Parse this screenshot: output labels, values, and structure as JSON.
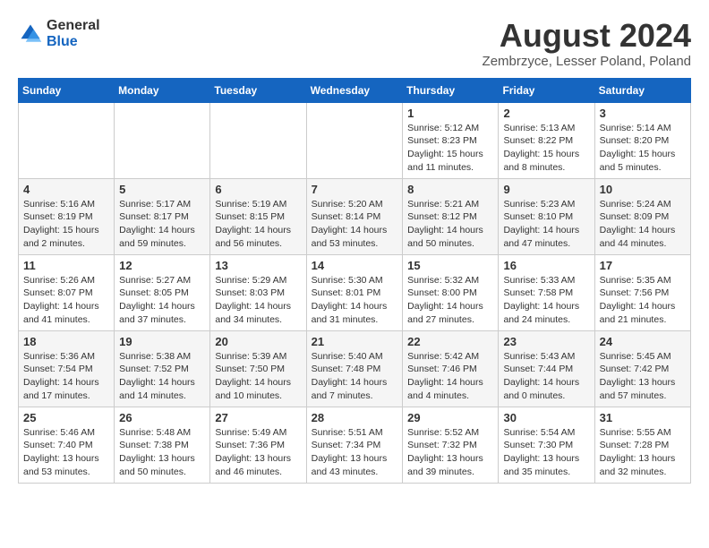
{
  "logo": {
    "general": "General",
    "blue": "Blue"
  },
  "header": {
    "title": "August 2024",
    "subtitle": "Zembrzyce, Lesser Poland, Poland"
  },
  "weekdays": [
    "Sunday",
    "Monday",
    "Tuesday",
    "Wednesday",
    "Thursday",
    "Friday",
    "Saturday"
  ],
  "weeks": [
    [
      {
        "day": "",
        "info": ""
      },
      {
        "day": "",
        "info": ""
      },
      {
        "day": "",
        "info": ""
      },
      {
        "day": "",
        "info": ""
      },
      {
        "day": "1",
        "info": "Sunrise: 5:12 AM\nSunset: 8:23 PM\nDaylight: 15 hours\nand 11 minutes."
      },
      {
        "day": "2",
        "info": "Sunrise: 5:13 AM\nSunset: 8:22 PM\nDaylight: 15 hours\nand 8 minutes."
      },
      {
        "day": "3",
        "info": "Sunrise: 5:14 AM\nSunset: 8:20 PM\nDaylight: 15 hours\nand 5 minutes."
      }
    ],
    [
      {
        "day": "4",
        "info": "Sunrise: 5:16 AM\nSunset: 8:19 PM\nDaylight: 15 hours\nand 2 minutes."
      },
      {
        "day": "5",
        "info": "Sunrise: 5:17 AM\nSunset: 8:17 PM\nDaylight: 14 hours\nand 59 minutes."
      },
      {
        "day": "6",
        "info": "Sunrise: 5:19 AM\nSunset: 8:15 PM\nDaylight: 14 hours\nand 56 minutes."
      },
      {
        "day": "7",
        "info": "Sunrise: 5:20 AM\nSunset: 8:14 PM\nDaylight: 14 hours\nand 53 minutes."
      },
      {
        "day": "8",
        "info": "Sunrise: 5:21 AM\nSunset: 8:12 PM\nDaylight: 14 hours\nand 50 minutes."
      },
      {
        "day": "9",
        "info": "Sunrise: 5:23 AM\nSunset: 8:10 PM\nDaylight: 14 hours\nand 47 minutes."
      },
      {
        "day": "10",
        "info": "Sunrise: 5:24 AM\nSunset: 8:09 PM\nDaylight: 14 hours\nand 44 minutes."
      }
    ],
    [
      {
        "day": "11",
        "info": "Sunrise: 5:26 AM\nSunset: 8:07 PM\nDaylight: 14 hours\nand 41 minutes."
      },
      {
        "day": "12",
        "info": "Sunrise: 5:27 AM\nSunset: 8:05 PM\nDaylight: 14 hours\nand 37 minutes."
      },
      {
        "day": "13",
        "info": "Sunrise: 5:29 AM\nSunset: 8:03 PM\nDaylight: 14 hours\nand 34 minutes."
      },
      {
        "day": "14",
        "info": "Sunrise: 5:30 AM\nSunset: 8:01 PM\nDaylight: 14 hours\nand 31 minutes."
      },
      {
        "day": "15",
        "info": "Sunrise: 5:32 AM\nSunset: 8:00 PM\nDaylight: 14 hours\nand 27 minutes."
      },
      {
        "day": "16",
        "info": "Sunrise: 5:33 AM\nSunset: 7:58 PM\nDaylight: 14 hours\nand 24 minutes."
      },
      {
        "day": "17",
        "info": "Sunrise: 5:35 AM\nSunset: 7:56 PM\nDaylight: 14 hours\nand 21 minutes."
      }
    ],
    [
      {
        "day": "18",
        "info": "Sunrise: 5:36 AM\nSunset: 7:54 PM\nDaylight: 14 hours\nand 17 minutes."
      },
      {
        "day": "19",
        "info": "Sunrise: 5:38 AM\nSunset: 7:52 PM\nDaylight: 14 hours\nand 14 minutes."
      },
      {
        "day": "20",
        "info": "Sunrise: 5:39 AM\nSunset: 7:50 PM\nDaylight: 14 hours\nand 10 minutes."
      },
      {
        "day": "21",
        "info": "Sunrise: 5:40 AM\nSunset: 7:48 PM\nDaylight: 14 hours\nand 7 minutes."
      },
      {
        "day": "22",
        "info": "Sunrise: 5:42 AM\nSunset: 7:46 PM\nDaylight: 14 hours\nand 4 minutes."
      },
      {
        "day": "23",
        "info": "Sunrise: 5:43 AM\nSunset: 7:44 PM\nDaylight: 14 hours\nand 0 minutes."
      },
      {
        "day": "24",
        "info": "Sunrise: 5:45 AM\nSunset: 7:42 PM\nDaylight: 13 hours\nand 57 minutes."
      }
    ],
    [
      {
        "day": "25",
        "info": "Sunrise: 5:46 AM\nSunset: 7:40 PM\nDaylight: 13 hours\nand 53 minutes."
      },
      {
        "day": "26",
        "info": "Sunrise: 5:48 AM\nSunset: 7:38 PM\nDaylight: 13 hours\nand 50 minutes."
      },
      {
        "day": "27",
        "info": "Sunrise: 5:49 AM\nSunset: 7:36 PM\nDaylight: 13 hours\nand 46 minutes."
      },
      {
        "day": "28",
        "info": "Sunrise: 5:51 AM\nSunset: 7:34 PM\nDaylight: 13 hours\nand 43 minutes."
      },
      {
        "day": "29",
        "info": "Sunrise: 5:52 AM\nSunset: 7:32 PM\nDaylight: 13 hours\nand 39 minutes."
      },
      {
        "day": "30",
        "info": "Sunrise: 5:54 AM\nSunset: 7:30 PM\nDaylight: 13 hours\nand 35 minutes."
      },
      {
        "day": "31",
        "info": "Sunrise: 5:55 AM\nSunset: 7:28 PM\nDaylight: 13 hours\nand 32 minutes."
      }
    ]
  ]
}
